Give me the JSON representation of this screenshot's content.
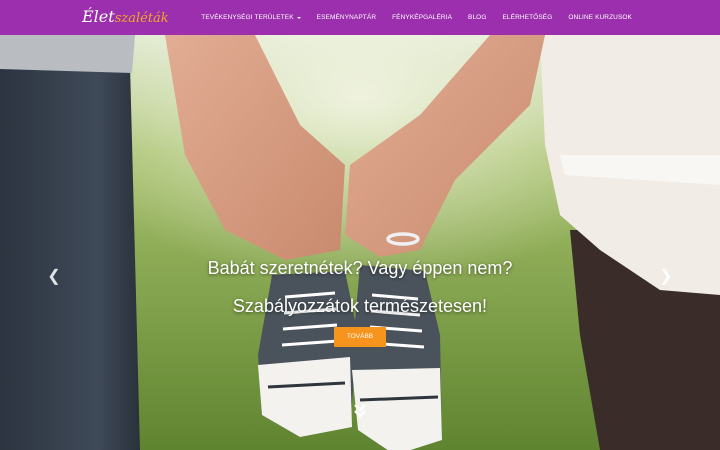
{
  "header": {
    "logo": {
      "part1": "Élet",
      "part2": "szaléták"
    },
    "nav": [
      {
        "label": "TEVÉKENYSÉGI TERÜLETEK",
        "has_dropdown": true
      },
      {
        "label": "ESEMÉNYNAPTÁR"
      },
      {
        "label": "FÉNYKÉPGALÉRIA"
      },
      {
        "label": "BLOG"
      },
      {
        "label": "ELÉRHETŐSÉG"
      },
      {
        "label": "ONLINE KURZUSOK"
      }
    ]
  },
  "hero": {
    "headline": "Babát szeretnétek? Vagy éppen nem?",
    "subheadline": "Szabályozzátok természetesen!",
    "cta_label": "TOVÁBB",
    "prev_icon": "chevron-left-icon",
    "next_icon": "chevron-right-icon",
    "scroll_icon": "double-chevron-down-icon"
  },
  "colors": {
    "navbar": "#9b2fae",
    "cta": "#f7941d",
    "text": "#ffffff"
  }
}
